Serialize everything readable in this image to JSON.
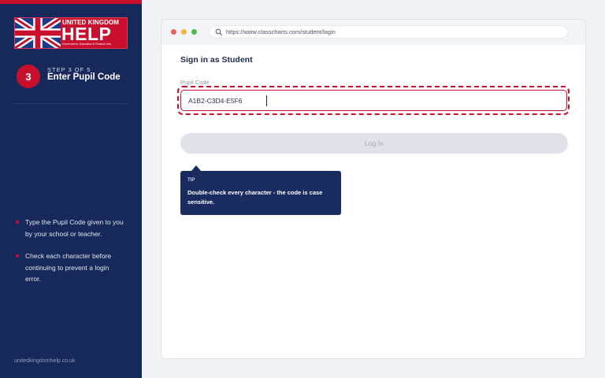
{
  "sidebar": {
    "logo": {
      "line1": "UNITED KINGDOM",
      "line2": "HELP",
      "tagline": "Government, Education & Finance Info"
    },
    "step": {
      "number": "3",
      "of_label": "STEP 3 OF 5",
      "title": "Enter Pupil Code"
    },
    "instructions": [
      "Type the Pupil Code given to you by your school or teacher.",
      "Check each character before continuing to prevent a login error."
    ],
    "footer_url": "unitedkingdomhelp.co.uk"
  },
  "browser": {
    "url": "https://www.classcharts.com/student/login",
    "page_title": "Sign in as Student",
    "pupil_code": {
      "label": "Pupil Code",
      "value": "A1B2-C3D4-E5F6"
    },
    "login_button": "Log In",
    "tip": {
      "label": "TIP",
      "text": "Double-check every character - the code is case sensitive."
    }
  },
  "colors": {
    "sidebar_bg": "#16295a",
    "accent_red": "#c8102e",
    "tooltip_bg": "#1a2c5f",
    "button_disabled": "#dfe2e9"
  },
  "icons": [
    "union-jack-flag",
    "search-icon"
  ]
}
